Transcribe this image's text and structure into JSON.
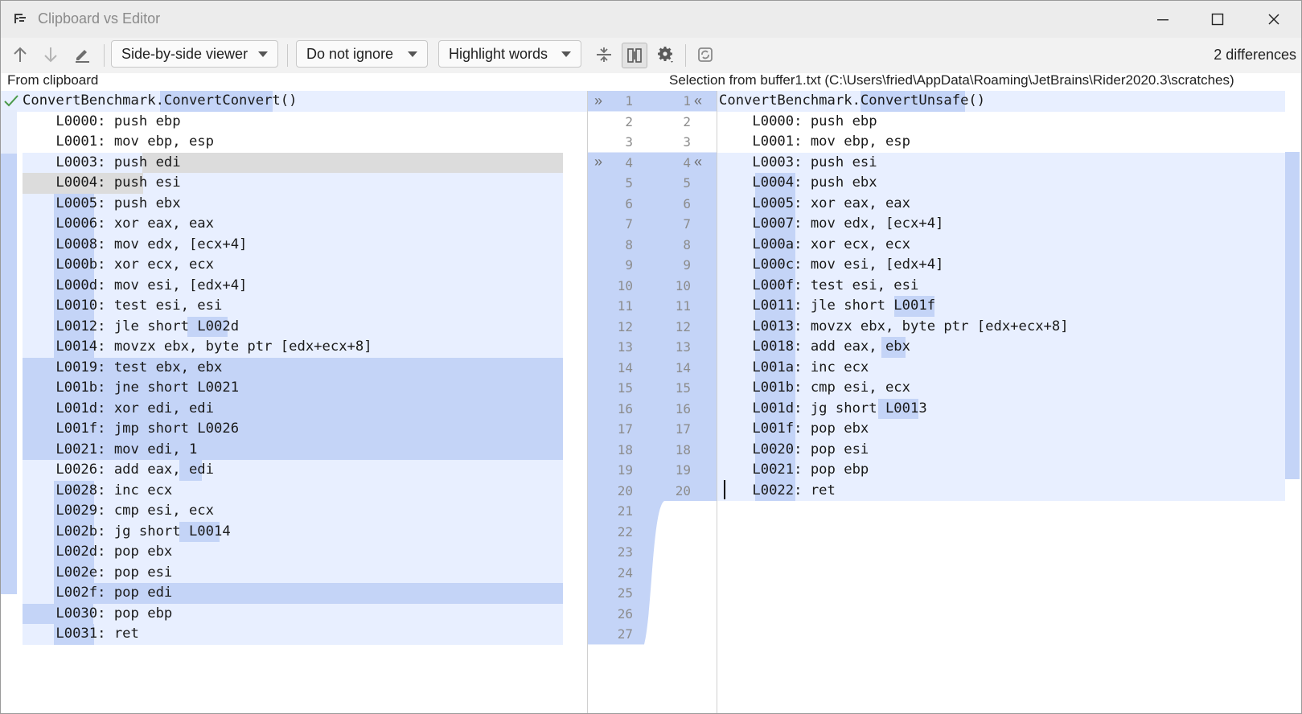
{
  "window": {
    "title": "Clipboard vs Editor"
  },
  "toolbar": {
    "viewer_label": "Side-by-side viewer",
    "ignore_label": "Do not ignore",
    "highlight_label": "Highlight words",
    "diff_count": "2 differences"
  },
  "headers": {
    "left": "From clipboard",
    "right": "Selection from buffer1.txt (C:\\Users\\fried\\AppData\\Roaming\\JetBrains\\Rider2020.3\\scratches)"
  },
  "colors": {
    "changed_bg": "#e8efff",
    "changed_strong": "#c4d4f7",
    "word_highlight": "#c4d4f7",
    "gray_selection": "#dcdcdc",
    "gutter_changed": "#c4d4f7"
  },
  "left_lines": [
    {
      "text": "ConvertBenchmark.ConvertConvert()"
    },
    {
      "text": "    L0000: push ebp"
    },
    {
      "text": "    L0001: mov ebp, esp"
    },
    {
      "text": "    L0003: push edi"
    },
    {
      "text": "    L0004: push esi"
    },
    {
      "text": "    L0005: push ebx"
    },
    {
      "text": "    L0006: xor eax, eax"
    },
    {
      "text": "    L0008: mov edx, [ecx+4]"
    },
    {
      "text": "    L000b: xor ecx, ecx"
    },
    {
      "text": "    L000d: mov esi, [edx+4]"
    },
    {
      "text": "    L0010: test esi, esi"
    },
    {
      "text": "    L0012: jle short L002d"
    },
    {
      "text": "    L0014: movzx ebx, byte ptr [edx+ecx+8]"
    },
    {
      "text": "    L0019: test ebx, ebx"
    },
    {
      "text": "    L001b: jne short L0021"
    },
    {
      "text": "    L001d: xor edi, edi"
    },
    {
      "text": "    L001f: jmp short L0026"
    },
    {
      "text": "    L0021: mov edi, 1"
    },
    {
      "text": "    L0026: add eax, edi"
    },
    {
      "text": "    L0028: inc ecx"
    },
    {
      "text": "    L0029: cmp esi, ecx"
    },
    {
      "text": "    L002b: jg short L0014"
    },
    {
      "text": "    L002d: pop ebx"
    },
    {
      "text": "    L002e: pop esi"
    },
    {
      "text": "    L002f: pop edi"
    },
    {
      "text": "    L0030: pop ebp"
    },
    {
      "text": "    L0031: ret"
    }
  ],
  "right_lines": [
    {
      "text": "ConvertBenchmark.ConvertUnsafe()"
    },
    {
      "text": "    L0000: push ebp"
    },
    {
      "text": "    L0001: mov ebp, esp"
    },
    {
      "text": "    L0003: push esi"
    },
    {
      "text": "    L0004: push ebx"
    },
    {
      "text": "    L0005: xor eax, eax"
    },
    {
      "text": "    L0007: mov edx, [ecx+4]"
    },
    {
      "text": "    L000a: xor ecx, ecx"
    },
    {
      "text": "    L000c: mov esi, [edx+4]"
    },
    {
      "text": "    L000f: test esi, esi"
    },
    {
      "text": "    L0011: jle short L001f"
    },
    {
      "text": "    L0013: movzx ebx, byte ptr [edx+ecx+8]"
    },
    {
      "text": "    L0018: add eax, ebx"
    },
    {
      "text": "    L001a: inc ecx"
    },
    {
      "text": "    L001b: cmp esi, ecx"
    },
    {
      "text": "    L001d: jg short L0013"
    },
    {
      "text": "    L001f: pop ebx"
    },
    {
      "text": "    L0020: pop esi"
    },
    {
      "text": "    L0021: pop ebp"
    },
    {
      "text": "    L0022: ret"
    }
  ],
  "left_numbers": [
    "1",
    "2",
    "3",
    "4",
    "5",
    "6",
    "7",
    "8",
    "9",
    "10",
    "11",
    "12",
    "13",
    "14",
    "15",
    "16",
    "17",
    "18",
    "19",
    "20",
    "21",
    "22",
    "23",
    "24",
    "25",
    "26",
    "27"
  ],
  "right_numbers": [
    "1",
    "2",
    "3",
    "4",
    "5",
    "6",
    "7",
    "8",
    "9",
    "10",
    "11",
    "12",
    "13",
    "14",
    "15",
    "16",
    "17",
    "18",
    "19",
    "20"
  ],
  "icons": {
    "prev": "arrow-up-icon",
    "next": "arrow-down-icon",
    "edit": "pencil-icon",
    "collapse": "collapse-unchanged-icon",
    "sync": "sync-scroll-icon",
    "settings": "gear-icon",
    "refresh": "refresh-icon",
    "apply_right": "double-chevron-right-icon",
    "apply_left": "double-chevron-left-icon"
  }
}
